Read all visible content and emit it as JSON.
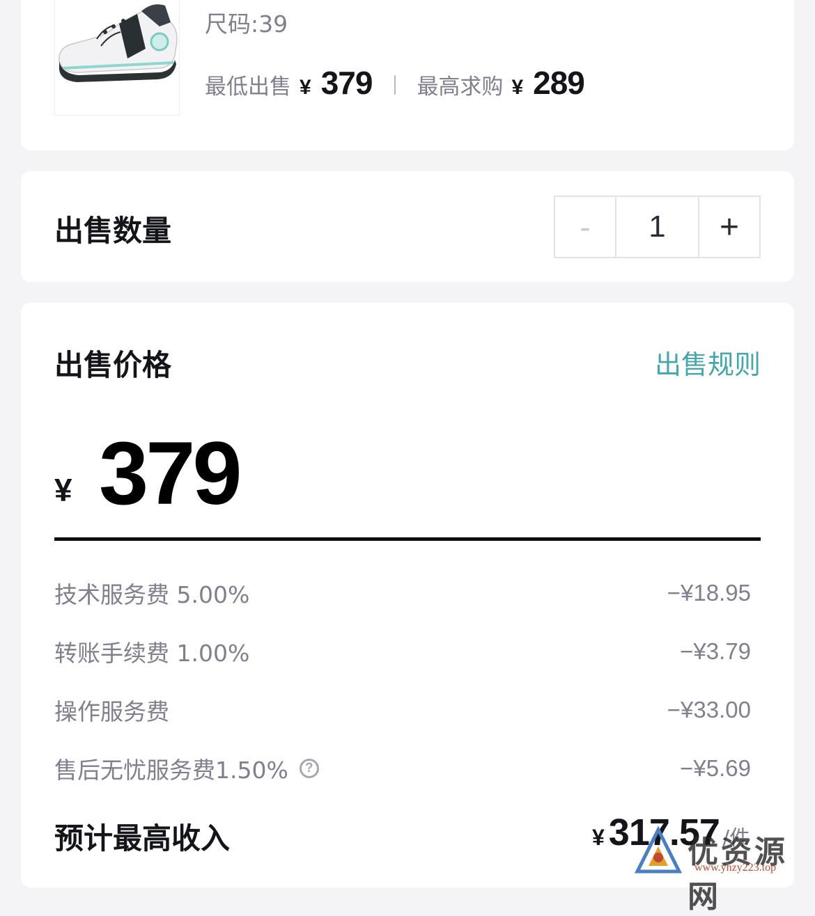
{
  "product": {
    "size_label": "尺码:39",
    "lowest_sell_label": "最低出售",
    "lowest_sell_currency": "¥",
    "lowest_sell_price": "379",
    "highest_bid_label": "最高求购",
    "highest_bid_currency": "¥",
    "highest_bid_price": "289"
  },
  "quantity": {
    "title": "出售数量",
    "minus": "-",
    "value": "1",
    "plus": "+"
  },
  "pricing": {
    "title": "出售价格",
    "rules_link": "出售规则",
    "currency": "¥",
    "price": "379",
    "fees": [
      {
        "label": "技术服务费 5.00%",
        "value": "−¥18.95"
      },
      {
        "label": "转账手续费 1.00%",
        "value": "−¥3.79"
      },
      {
        "label": "操作服务费",
        "value": "−¥33.00"
      },
      {
        "label": "售后无忧服务费1.50%",
        "value": "−¥5.69",
        "help_icon": "?"
      }
    ],
    "income_label": "预计最高收入",
    "income_currency": "¥",
    "income_value": "317.57",
    "income_unit": "/件"
  },
  "watermark": {
    "text": "优资源网",
    "url": "www.yhzy223.top"
  },
  "colors": {
    "accent": "#46a6ad",
    "background": "#f4f4f7",
    "muted_text": "#7f7f8e"
  }
}
